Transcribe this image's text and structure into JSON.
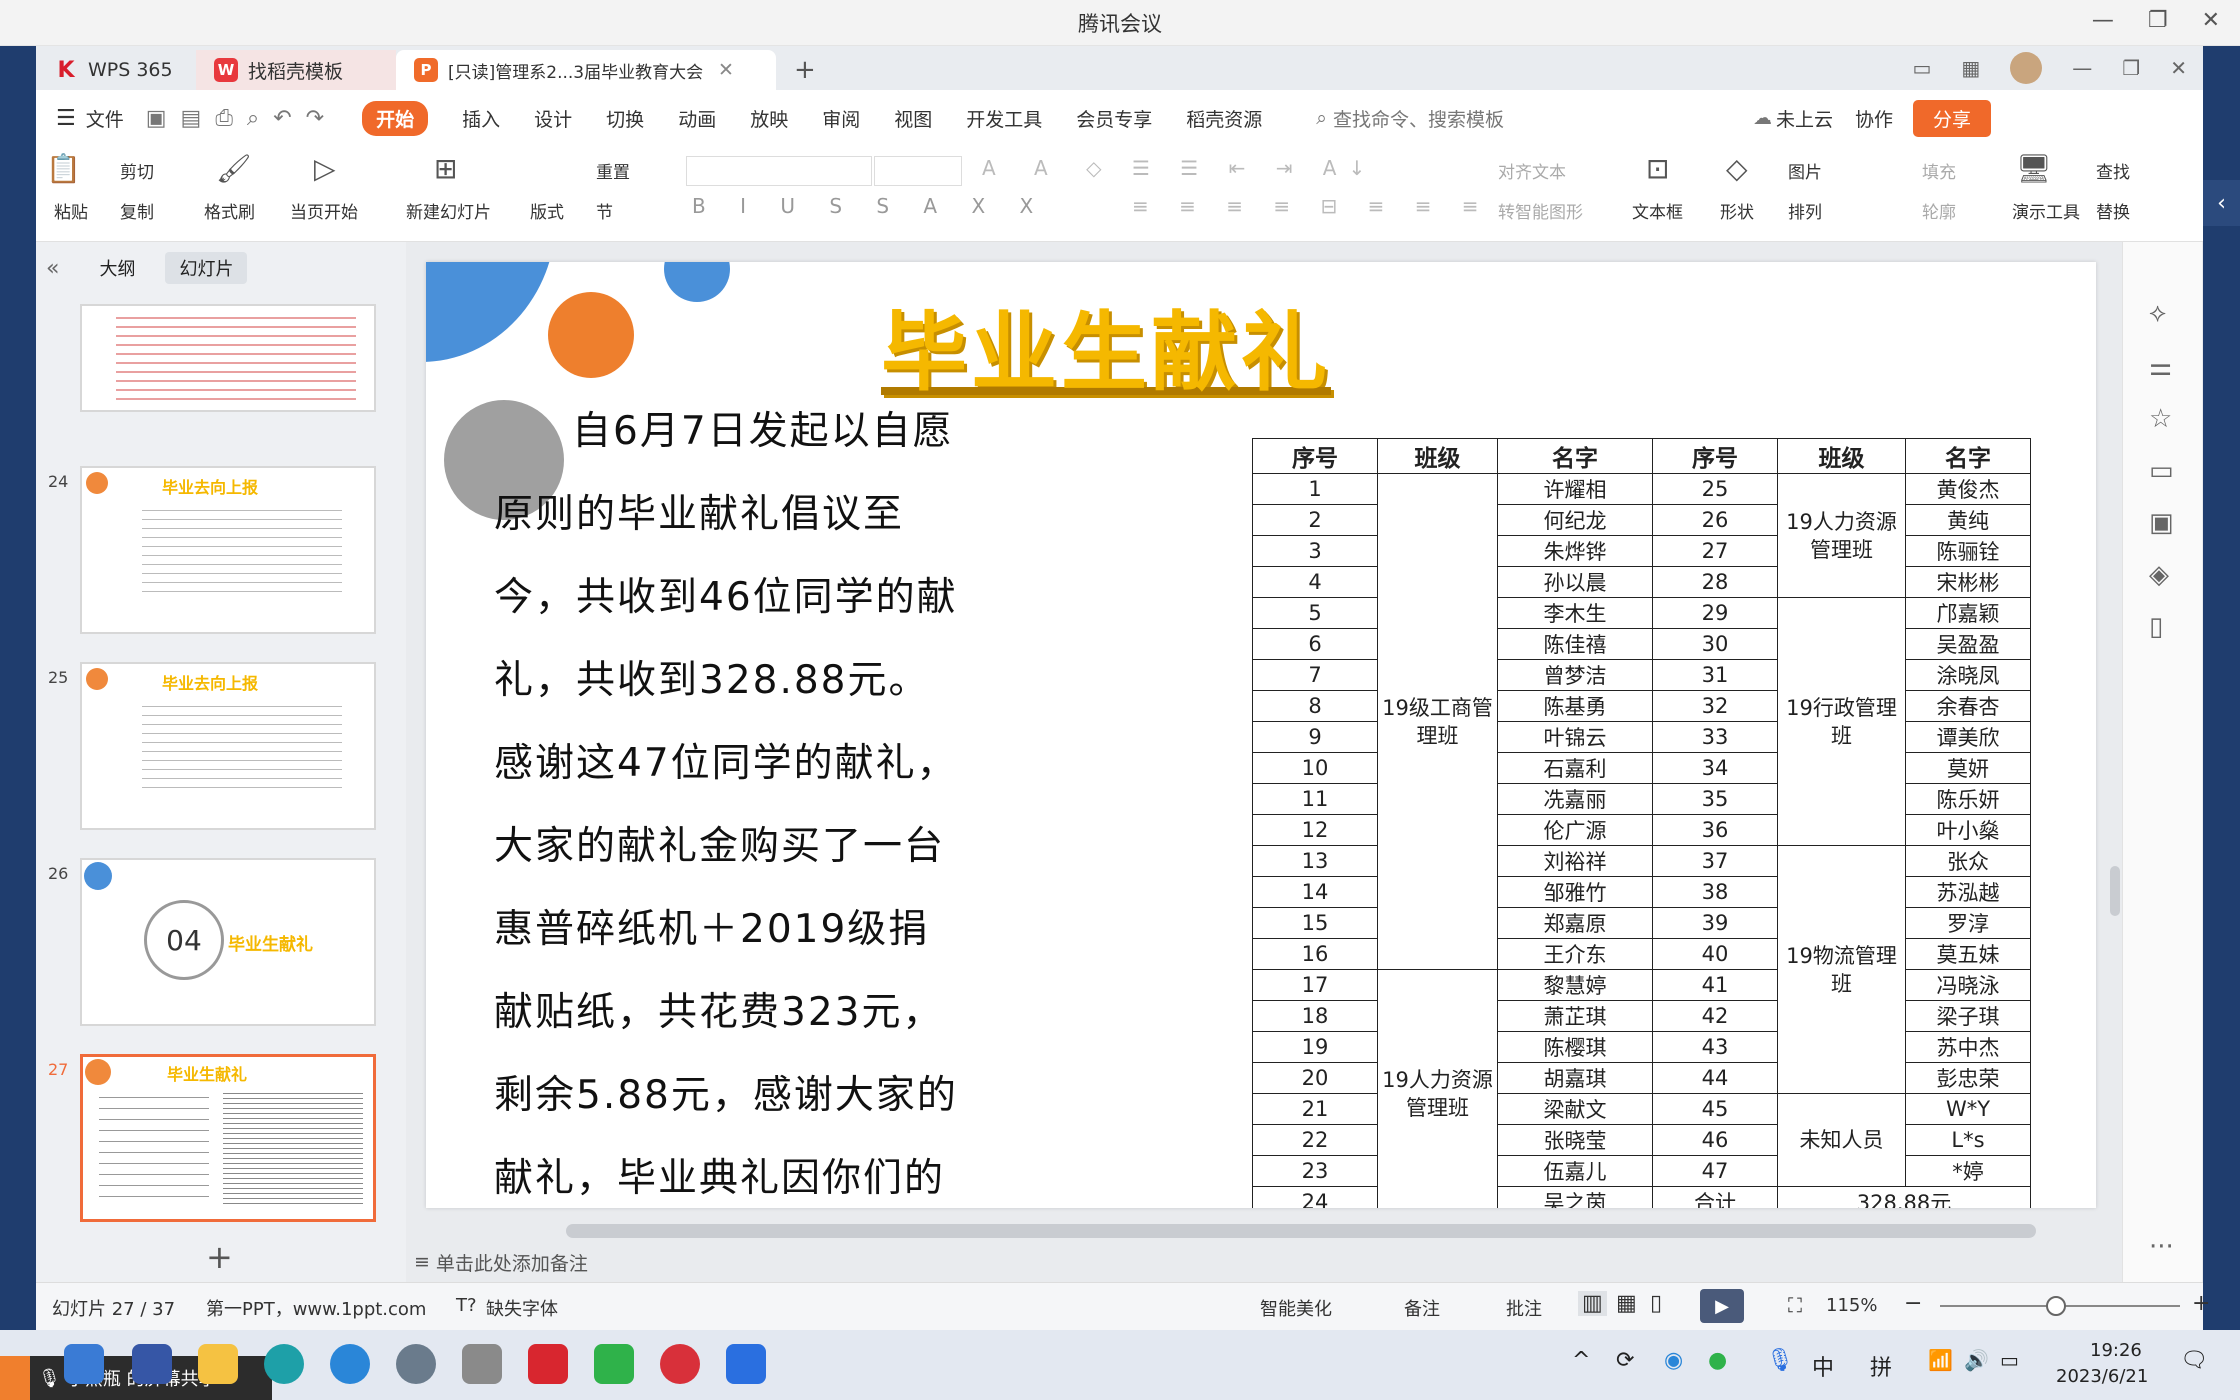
{
  "meeting": {
    "title": "腾讯会议"
  },
  "tabs": [
    {
      "label": "WPS 365"
    },
    {
      "label": "找稻壳模板"
    },
    {
      "label": "[只读]管理系2...3届毕业教育大会"
    }
  ],
  "menu": [
    "文件",
    "开始",
    "插入",
    "设计",
    "切换",
    "动画",
    "放映",
    "审阅",
    "视图",
    "开发工具",
    "会员专享",
    "稻壳资源"
  ],
  "search_placeholder": "查找命令、搜索模板",
  "cloud": {
    "status": "未上云",
    "collab": "协作",
    "share": "分享"
  },
  "ribbon": {
    "paste": "粘贴",
    "cut": "剪切",
    "copy": "复制",
    "format_painter": "格式刷",
    "from_current": "当页开始",
    "new_slide": "新建幻灯片",
    "layout": "版式",
    "reset": "重置",
    "section": "节",
    "align_text": "对齐文本",
    "smart_shape": "转智能图形",
    "textbox": "文本框",
    "shape": "形状",
    "picture": "图片",
    "fill": "填充",
    "arrange": "排列",
    "outline": "轮廓",
    "present_tools": "演示工具",
    "find": "查找",
    "replace": "替换"
  },
  "panel": {
    "outline_tab": "大纲",
    "slides_tab": "幻灯片"
  },
  "thumbnails": [
    {
      "num": "24",
      "title": "毕业去向上报"
    },
    {
      "num": "25",
      "title": "毕业去向上报"
    },
    {
      "num": "26",
      "title": "毕业生献礼",
      "badge": "04"
    },
    {
      "num": "27",
      "title": "毕业生献礼"
    }
  ],
  "slide": {
    "title": "毕业生献礼",
    "body": "自6月7日发起以自愿原则的毕业献礼倡议至今，共收到46位同学的献礼，共收到328.88元。感谢这47位同学的献礼，大家的献礼金购买了一台惠普碎纸机＋2019级捐献贴纸，共花费323元，剩余5.88元，感谢大家的献礼，毕业典礼因你们的献礼而更加温暖。",
    "table": {
      "headers": [
        "序号",
        "班级",
        "名字",
        "序号",
        "班级",
        "名字"
      ],
      "left_rows": [
        [
          "1",
          "许耀相"
        ],
        [
          "2",
          "何纪龙"
        ],
        [
          "3",
          "朱烨铧"
        ],
        [
          "4",
          "孙以晨"
        ],
        [
          "5",
          "李木生"
        ],
        [
          "6",
          "陈佳禧"
        ],
        [
          "7",
          "曾梦洁"
        ],
        [
          "8",
          "陈基勇"
        ],
        [
          "9",
          "叶锦云"
        ],
        [
          "10",
          "石嘉利"
        ],
        [
          "11",
          "冼嘉丽"
        ],
        [
          "12",
          "伦广源"
        ],
        [
          "13",
          "刘裕祥"
        ],
        [
          "14",
          "邹雅竹"
        ],
        [
          "15",
          "郑嘉原"
        ],
        [
          "16",
          "王介东"
        ],
        [
          "17",
          "黎慧婷"
        ],
        [
          "18",
          "萧芷琪"
        ],
        [
          "19",
          "陈樱琪"
        ],
        [
          "20",
          "胡嘉琪"
        ],
        [
          "21",
          "梁献文"
        ],
        [
          "22",
          "张晓莹"
        ],
        [
          "23",
          "伍嘉儿"
        ],
        [
          "24",
          "吴之茵"
        ]
      ],
      "right_rows": [
        [
          "25",
          "黄俊杰"
        ],
        [
          "26",
          "黄纯"
        ],
        [
          "27",
          "陈骊铨"
        ],
        [
          "28",
          "宋彬彬"
        ],
        [
          "29",
          "邝嘉颖"
        ],
        [
          "30",
          "吴盈盈"
        ],
        [
          "31",
          "涂晓凤"
        ],
        [
          "32",
          "余春杏"
        ],
        [
          "33",
          "谭美欣"
        ],
        [
          "34",
          "莫妍"
        ],
        [
          "35",
          "陈乐妍"
        ],
        [
          "36",
          "叶小燊"
        ],
        [
          "37",
          "张众"
        ],
        [
          "38",
          "苏泓越"
        ],
        [
          "39",
          "罗淳"
        ],
        [
          "40",
          "莫五妹"
        ],
        [
          "41",
          "冯晓泳"
        ],
        [
          "42",
          "梁子琪"
        ],
        [
          "43",
          "苏中杰"
        ],
        [
          "44",
          "彭忠荣"
        ],
        [
          "45",
          "W*Y"
        ],
        [
          "46",
          "L*s"
        ],
        [
          "47",
          "*婷"
        ]
      ],
      "left_classes": [
        "19级工商管理班",
        "19人力资源管理班"
      ],
      "right_classes": [
        "19人力资源管理班",
        "19行政管理班",
        "19物流管理班",
        "未知人员"
      ],
      "total_label": "合计",
      "total_value": "328.88元"
    }
  },
  "notes_placeholder": "单击此处添加备注",
  "status": {
    "slide_count": "幻灯片 27 / 37",
    "theme": "第一PPT，www.1ppt.com",
    "missing_font": "缺失字体",
    "beautify": "智能美化",
    "notes": "备注",
    "comment": "批注",
    "zoom": "115%"
  },
  "taskbar": {
    "screen_share": "小黑瓶   的屏幕共享",
    "time": "19:26",
    "date": "2023/6/21",
    "ime1": "中",
    "ime2": "拼"
  }
}
